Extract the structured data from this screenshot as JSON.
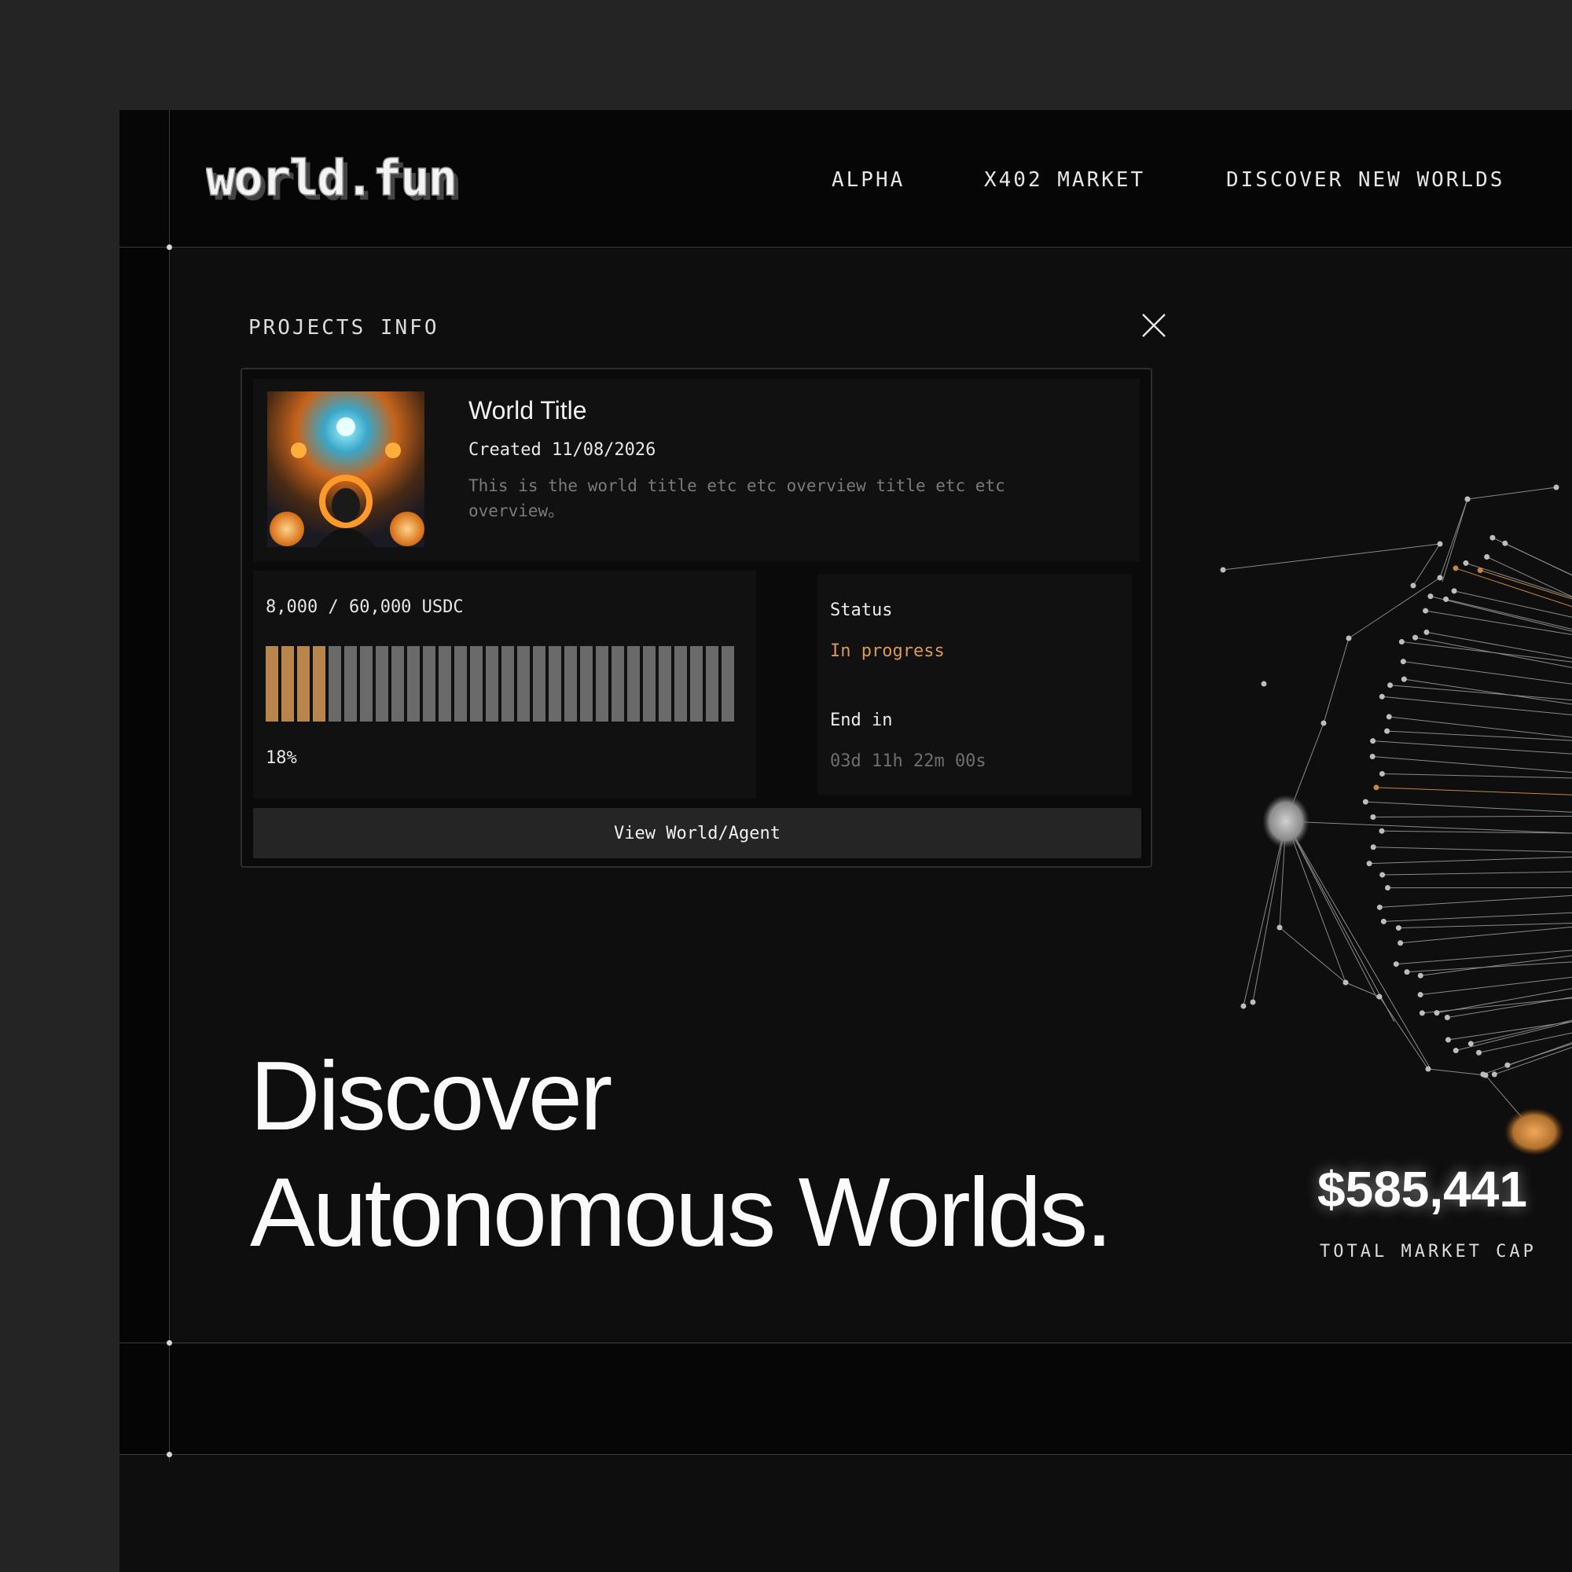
{
  "header": {
    "logo_text": "world.fun",
    "nav": [
      {
        "label": "ALPHA"
      },
      {
        "label": "X402 MARKET"
      },
      {
        "label": "DISCOVER NEW WORLDS"
      }
    ]
  },
  "panel": {
    "title": "PROJECTS INFO",
    "close_icon": "close-icon",
    "world": {
      "title": "World Title",
      "created": "Created 11/08/2026",
      "description": "This is the world title etc etc overview title etc etc overview。"
    },
    "funding": {
      "amount": "8,000 / 60,000 USDC",
      "percent_label": "18%",
      "progress": 0.18,
      "total_segments": 30,
      "filled_segments": 4
    },
    "status": {
      "label": "Status",
      "value": "In progress",
      "end_label": "End in",
      "end_value": "03d 11h 22m 00s"
    },
    "view_button": "View World/Agent"
  },
  "hero": {
    "line1": "Discover",
    "line2": "Autonomous Worlds."
  },
  "stats": {
    "market_cap": "$585,441",
    "market_cap_label": "TOTAL MARKET CAP"
  },
  "colors": {
    "accent": "#b8864c",
    "status_text": "#d99a55",
    "bar_inactive": "#6a6a6a",
    "background": "#0e0e0e"
  }
}
